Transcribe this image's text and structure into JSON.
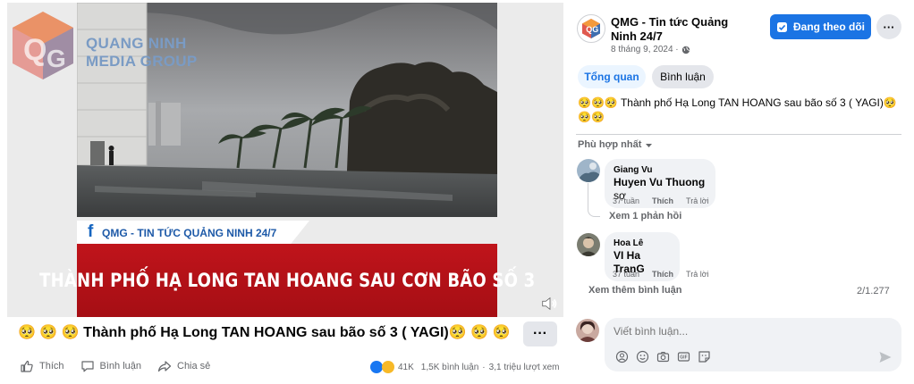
{
  "video": {
    "brand_line1": "QUANG NINH",
    "brand_line2": "MEDIA GROUP",
    "caption_strip": "QMG - TIN TỨC QUẢNG NINH 24/7",
    "banner_text": "THÀNH PHỐ HẠ LONG TAN HOANG SAU CƠN BÃO SỐ 3"
  },
  "post": {
    "title": "🥺 🥺 🥺 Thành phố Hạ Long TAN HOANG sau bão số 3 ( YAGI)🥺 🥺 🥺",
    "more_label": "···",
    "actions": {
      "like": "Thích",
      "comment": "Bình luận",
      "share": "Chia sẻ"
    },
    "stats": {
      "reactions": "41K",
      "comments": "1,5K bình luận",
      "separator": "·",
      "views": "3,1 triệu lượt xem"
    }
  },
  "sidebar": {
    "page_name": "QMG - Tin tức Quảng Ninh 24/7",
    "date": "8 tháng 9, 2024 ·",
    "follow_label": "Đang theo dõi",
    "more_label": "···",
    "tabs": [
      "Tổng quan",
      "Bình luận"
    ],
    "caption": "🥺🥺🥺 Thành phố Hạ Long TAN HOANG sau bão số 3 ( YAGI)🥺🥺🥺",
    "sort_label": "Phù hợp nhất",
    "comments": [
      {
        "author": "Giang Vu",
        "mention": "Huyen Vu Thuong",
        "text": " sợ",
        "time": "37 tuần",
        "like": "Thích",
        "reply": "Trả lời"
      },
      {
        "author": "Hoa Lê",
        "mention": "VI Ha TranG",
        "text": "",
        "time": "37 tuần",
        "like": "Thích",
        "reply": "Trả lời"
      }
    ],
    "view_replies": "Xem 1 phản hồi",
    "more_comments": "Xem thêm bình luận",
    "comment_count": "2/1.277",
    "composer_placeholder": "Viết bình luận..."
  },
  "colors": {
    "accent": "#1b74e4",
    "banner_red": "#b3121a",
    "brand_blue": "#7a9bc4"
  }
}
